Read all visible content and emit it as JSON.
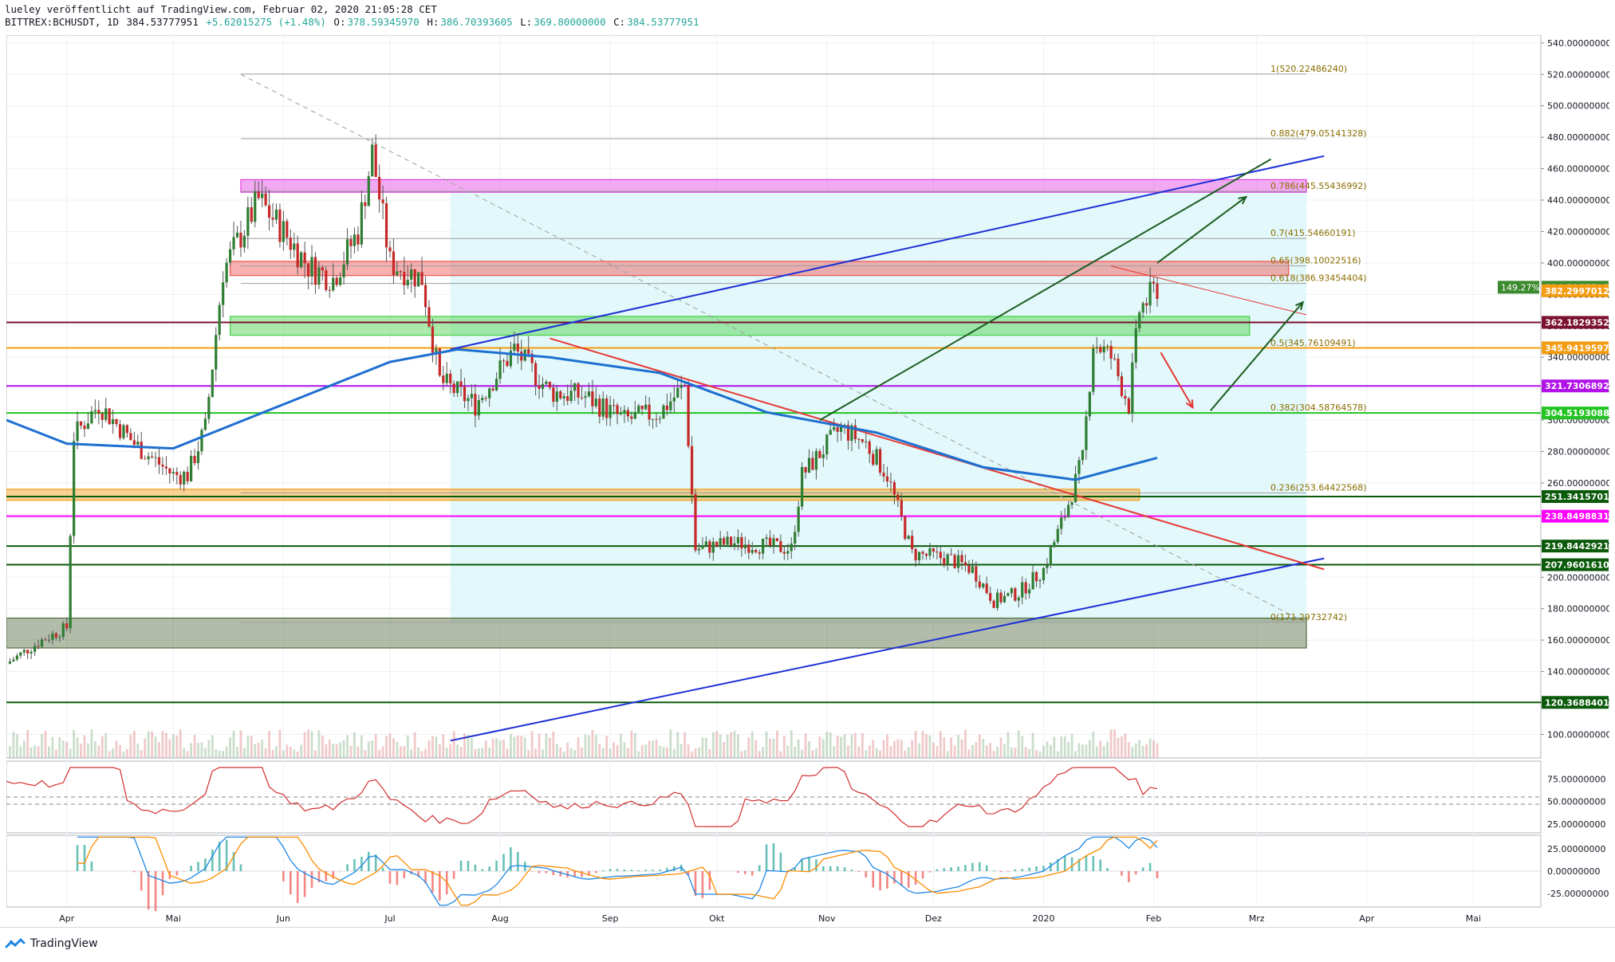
{
  "header": {
    "published": "lueley veröffentlicht auf TradingView.com, Februar 02, 2020 21:05:28 CET",
    "symbol": "BITTREX:BCHUSDT, 1D",
    "last": "384.53777951",
    "change": "+5.62015275 (+1.48%)",
    "ohlc": [
      {
        "k": "O:",
        "v": "378.59345970"
      },
      {
        "k": "H:",
        "v": "386.70393605"
      },
      {
        "k": "L:",
        "v": "369.80000000"
      },
      {
        "k": "C:",
        "v": "384.53777951"
      }
    ]
  },
  "footer": {
    "brand": "TradingView"
  },
  "colors": {
    "up": "#26a69a",
    "down": "#ef5350",
    "blue": "#1c2fd6",
    "ma": "#1e6fd0",
    "fib": "#00bcd4",
    "grid": "#eef0f3",
    "text": "#131722"
  },
  "chart_data": {
    "type": "candlestick",
    "symbol": "BITTREX:BCHUSDT",
    "timeframe": "1D",
    "ylim": [
      85,
      545
    ],
    "xlim": [
      "2019-03-15",
      "2020-05-20"
    ],
    "y_ticks": [
      "540.00000000",
      "520.00000000",
      "500.00000000",
      "480.00000000",
      "460.00000000",
      "440.00000000",
      "420.00000000",
      "400.00000000",
      "380.00000000",
      "360.00000000",
      "340.00000000",
      "320.00000000",
      "300.00000000",
      "280.00000000",
      "260.00000000",
      "240.00000000",
      "220.00000000",
      "200.00000000",
      "180.00000000",
      "160.00000000",
      "140.00000000",
      "120.00000000",
      "100.00000000"
    ],
    "x_ticks": [
      {
        "label": "Apr",
        "date": "2019-04-01"
      },
      {
        "label": "Mai",
        "date": "2019-05-01"
      },
      {
        "label": "Jun",
        "date": "2019-06-01"
      },
      {
        "label": "Jul",
        "date": "2019-07-01"
      },
      {
        "label": "Aug",
        "date": "2019-08-01"
      },
      {
        "label": "Sep",
        "date": "2019-09-01"
      },
      {
        "label": "Okt",
        "date": "2019-10-01"
      },
      {
        "label": "Nov",
        "date": "2019-11-01"
      },
      {
        "label": "Dez",
        "date": "2019-12-01"
      },
      {
        "label": "2020",
        "date": "2020-01-01"
      },
      {
        "label": "Feb",
        "date": "2020-02-01"
      },
      {
        "label": "Mrz",
        "date": "2020-03-01"
      },
      {
        "label": "Apr",
        "date": "2020-04-01"
      },
      {
        "label": "Mai",
        "date": "2020-05-01"
      }
    ],
    "close_path": [
      [
        "2019-03-15",
        145
      ],
      [
        "2019-03-25",
        160
      ],
      [
        "2019-04-01",
        168
      ],
      [
        "2019-04-03",
        290
      ],
      [
        "2019-04-10",
        310
      ],
      [
        "2019-04-20",
        285
      ],
      [
        "2019-05-01",
        265
      ],
      [
        "2019-05-05",
        265
      ],
      [
        "2019-05-10",
        295
      ],
      [
        "2019-05-15",
        395
      ],
      [
        "2019-05-25",
        440
      ],
      [
        "2019-06-01",
        420
      ],
      [
        "2019-06-08",
        398
      ],
      [
        "2019-06-15",
        390
      ],
      [
        "2019-06-22",
        420
      ],
      [
        "2019-06-26",
        470
      ],
      [
        "2019-07-01",
        400
      ],
      [
        "2019-07-10",
        390
      ],
      [
        "2019-07-15",
        325
      ],
      [
        "2019-07-25",
        310
      ],
      [
        "2019-08-05",
        345
      ],
      [
        "2019-08-15",
        318
      ],
      [
        "2019-08-25",
        315
      ],
      [
        "2019-09-05",
        300
      ],
      [
        "2019-09-15",
        305
      ],
      [
        "2019-09-22",
        322
      ],
      [
        "2019-09-25",
        218
      ],
      [
        "2019-10-05",
        222
      ],
      [
        "2019-10-15",
        220
      ],
      [
        "2019-10-22",
        218
      ],
      [
        "2019-10-25",
        265
      ],
      [
        "2019-11-05",
        295
      ],
      [
        "2019-11-12",
        285
      ],
      [
        "2019-11-18",
        265
      ],
      [
        "2019-11-25",
        215
      ],
      [
        "2019-12-05",
        212
      ],
      [
        "2019-12-12",
        205
      ],
      [
        "2019-12-18",
        185
      ],
      [
        "2019-12-25",
        190
      ],
      [
        "2020-01-01",
        205
      ],
      [
        "2020-01-07",
        240
      ],
      [
        "2020-01-12",
        275
      ],
      [
        "2020-01-15",
        350
      ],
      [
        "2020-01-20",
        340
      ],
      [
        "2020-01-25",
        310
      ],
      [
        "2020-01-28",
        370
      ],
      [
        "2020-02-02",
        384.54
      ]
    ],
    "ma200": [
      [
        "2019-03-15",
        300
      ],
      [
        "2019-04-01",
        285
      ],
      [
        "2019-05-01",
        282
      ],
      [
        "2019-06-01",
        310
      ],
      [
        "2019-07-01",
        337
      ],
      [
        "2019-07-20",
        345
      ],
      [
        "2019-08-15",
        340
      ],
      [
        "2019-09-15",
        330
      ],
      [
        "2019-10-15",
        305
      ],
      [
        "2019-11-15",
        292
      ],
      [
        "2019-12-15",
        270
      ],
      [
        "2020-01-10",
        262
      ],
      [
        "2020-02-02",
        276
      ]
    ],
    "fib_levels": [
      {
        "ratio": 1,
        "value": 520.2248624,
        "label": "1(520.22486240)"
      },
      {
        "ratio": 0.882,
        "value": 479.05141328,
        "label": "0.882(479.05141328)"
      },
      {
        "ratio": 0.786,
        "value": 445.55436992,
        "label": "0.786(445.55436992)"
      },
      {
        "ratio": 0.7,
        "value": 415.54660191,
        "label": "0.7(415.54660191)"
      },
      {
        "ratio": 0.65,
        "value": 398.10022516,
        "label": "0.65(398.10022516)"
      },
      {
        "ratio": 0.618,
        "value": 386.93454404,
        "label": "0.618(386.93454404)"
      },
      {
        "ratio": 0.5,
        "value": 345.76109491,
        "label": "0.5(345.76109491)"
      },
      {
        "ratio": 0.382,
        "value": 304.58764578,
        "label": "0.382(304.58764578)"
      },
      {
        "ratio": 0.236,
        "value": 253.64422568,
        "label": "0.236(253.64422568)"
      },
      {
        "ratio": 0,
        "value": 171.29732742,
        "label": "0(171.29732742)"
      }
    ],
    "horizontal_levels": [
      {
        "value": 362.18293524,
        "label": "362.18293524",
        "color": "#7b1030"
      },
      {
        "value": 345.94195974,
        "label": "345.94195974",
        "color": "#f39c12"
      },
      {
        "value": 321.73068929,
        "label": "321.73068929",
        "color": "#b012e8"
      },
      {
        "value": 304.51930882,
        "label": "304.51930882",
        "color": "#22c322"
      },
      {
        "value": 251.34157013,
        "label": "251.34157013",
        "color": "#0b5a0b"
      },
      {
        "value": 238.84988315,
        "label": "238.84988315",
        "color": "#ff00ff"
      },
      {
        "value": 219.84429212,
        "label": "219.84429212",
        "color": "#0b5a0b"
      },
      {
        "value": 207.96016103,
        "label": "207.96016103",
        "color": "#0b5a0b"
      },
      {
        "value": 120.36884016,
        "label": "120.36884016",
        "color": "#0b5a0b"
      }
    ],
    "price_tags": [
      {
        "value": 384.53777951,
        "label": "384.53777951",
        "color": "#3c8a2e"
      },
      {
        "value": 382.29970122,
        "label": "382.29970122",
        "color": "#f39c12"
      }
    ],
    "change_badge": "149.27%",
    "zones": [
      {
        "from": 445,
        "to": 453,
        "date_from": "2019-05-20",
        "date_to": "2020-03-15",
        "color": "#e040e0"
      },
      {
        "from": 392,
        "to": 401,
        "date_from": "2019-05-17",
        "date_to": "2020-03-10",
        "color": "#ef5350"
      },
      {
        "from": 354,
        "to": 366,
        "date_from": "2019-05-17",
        "date_to": "2020-02-28",
        "color": "#44d044"
      },
      {
        "from": 249,
        "to": 256,
        "date_from": "2019-03-15",
        "date_to": "2020-01-28",
        "color": "#f39c12"
      },
      {
        "from": 155,
        "to": 174,
        "date_from": "2019-03-15",
        "date_to": "2020-03-15",
        "color": "#556b3f"
      }
    ],
    "oscillator1": {
      "ylim": [
        15,
        95
      ],
      "ticks": [
        "75.00000000",
        "50.00000000",
        "25.00000000"
      ],
      "bands": [
        55,
        47
      ]
    },
    "oscillator2": {
      "ylim": [
        -40,
        40
      ],
      "ticks": [
        "25.00000000",
        "0.00000000",
        "-25.00000000"
      ]
    }
  }
}
